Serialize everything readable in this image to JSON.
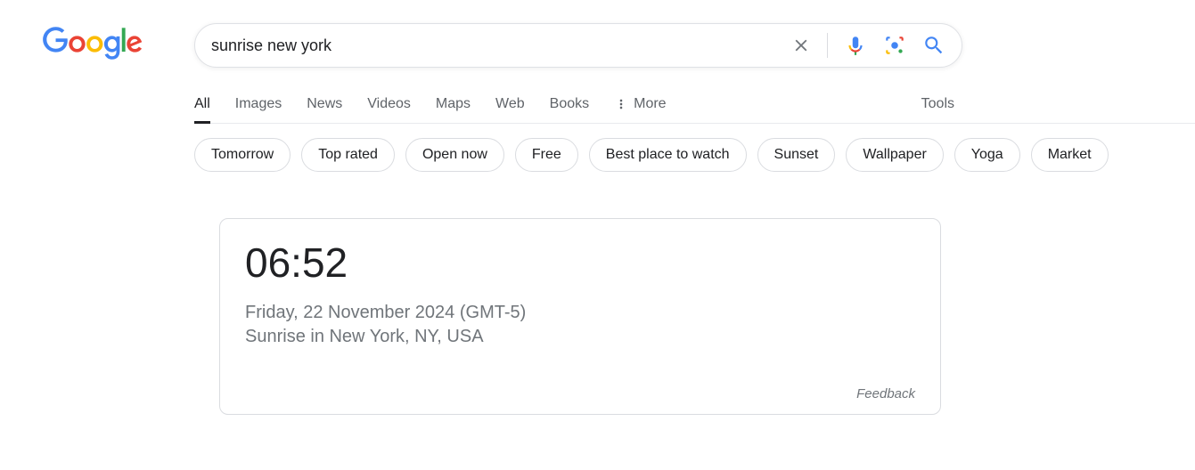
{
  "search": {
    "query": "sunrise new york"
  },
  "tabs": {
    "all": "All",
    "images": "Images",
    "news": "News",
    "videos": "Videos",
    "maps": "Maps",
    "web": "Web",
    "books": "Books",
    "more": "More",
    "tools": "Tools"
  },
  "chips": {
    "0": "Tomorrow",
    "1": "Top rated",
    "2": "Open now",
    "3": "Free",
    "4": "Best place to watch",
    "5": "Sunset",
    "6": "Wallpaper",
    "7": "Yoga",
    "8": "Market"
  },
  "result": {
    "time": "06:52",
    "date": "Friday, 22 November 2024 (GMT-5)",
    "location": "Sunrise in New York, NY, USA",
    "feedback": "Feedback"
  }
}
